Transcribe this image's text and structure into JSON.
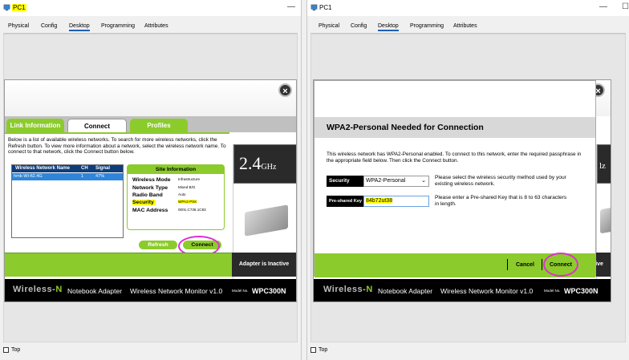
{
  "left": {
    "title": "PC1",
    "tabs": [
      "Physical",
      "Config",
      "Desktop",
      "Programming",
      "Attributes"
    ],
    "link_tabs": [
      "Link Information",
      "Connect",
      "Profiles"
    ],
    "description": "Below is a list of available wireless networks. To search for more wireless networks, click the Refresh button. To view more information about a network, select the wireless network name. To connect to that network, click the Connect button below.",
    "list_headers": [
      "Wireless Network Name",
      "CH",
      "Signal"
    ],
    "networks": [
      {
        "name": "hmk-Wi-fi2.4G",
        "ch": "1",
        "signal": "47%"
      }
    ],
    "site_info_title": "Site Information",
    "site_info": [
      {
        "label": "Wireless Mode",
        "value": "Infrastructure"
      },
      {
        "label": "Network Type",
        "value": "Mixed B/G"
      },
      {
        "label": "Radio Band",
        "value": "Auto"
      },
      {
        "label": "Security",
        "value": "WPA2-PSK"
      },
      {
        "label": "MAC Address",
        "value": "0001.C736.1C83"
      }
    ],
    "refresh_label": "Refresh",
    "connect_label": "Connect",
    "ghz_value": "2.4",
    "ghz_unit": "GHz",
    "adapter_status": "Adapter is Inactive",
    "footer_brand_a": "Wireless-",
    "footer_brand_b": "N",
    "footer_product": "Notebook Adapter",
    "footer_monitor": "Wireless Network Monitor  v1.0",
    "footer_model_prefix": "Model No.",
    "footer_model": "WPC300N",
    "top_label": "Top"
  },
  "right": {
    "title": "PC1",
    "tabs": [
      "Physical",
      "Config",
      "Desktop",
      "Programming",
      "Attributes"
    ],
    "modal_title": "WPA2-Personal Needed for Connection",
    "modal_text": "This wireless network has WPA2-Personal enabled. To connect to this network, enter the required passphrase in the appropriate field below. Then click the Connect button.",
    "security_label": "Security",
    "security_value": "WPA2-Personal",
    "security_help": "Please select the wireless security method used by your existing wireless network.",
    "psk_label": "Pre-shared Key",
    "psk_value": "84b72ut38",
    "psk_help": "Please enter a Pre-shared Key that is 8 to 63 characters in length.",
    "cancel_label": "Cancel",
    "connect_label": "Connect",
    "partial_ghz": "lz",
    "partial_status": "ctive",
    "footer_brand_a": "Wireless-",
    "footer_brand_b": "N",
    "footer_product": "Notebook Adapter",
    "footer_monitor": "Wireless Network Monitor  v1.0",
    "footer_model_prefix": "Model No.",
    "footer_model": "WPC300N",
    "top_label": "Top"
  },
  "colors": {
    "accent_green": "#8ccb2c",
    "highlight": "#ffff00",
    "annotation": "#e12ed3",
    "list_header": "#0e3d7a",
    "selected_row": "#2e85d9"
  }
}
